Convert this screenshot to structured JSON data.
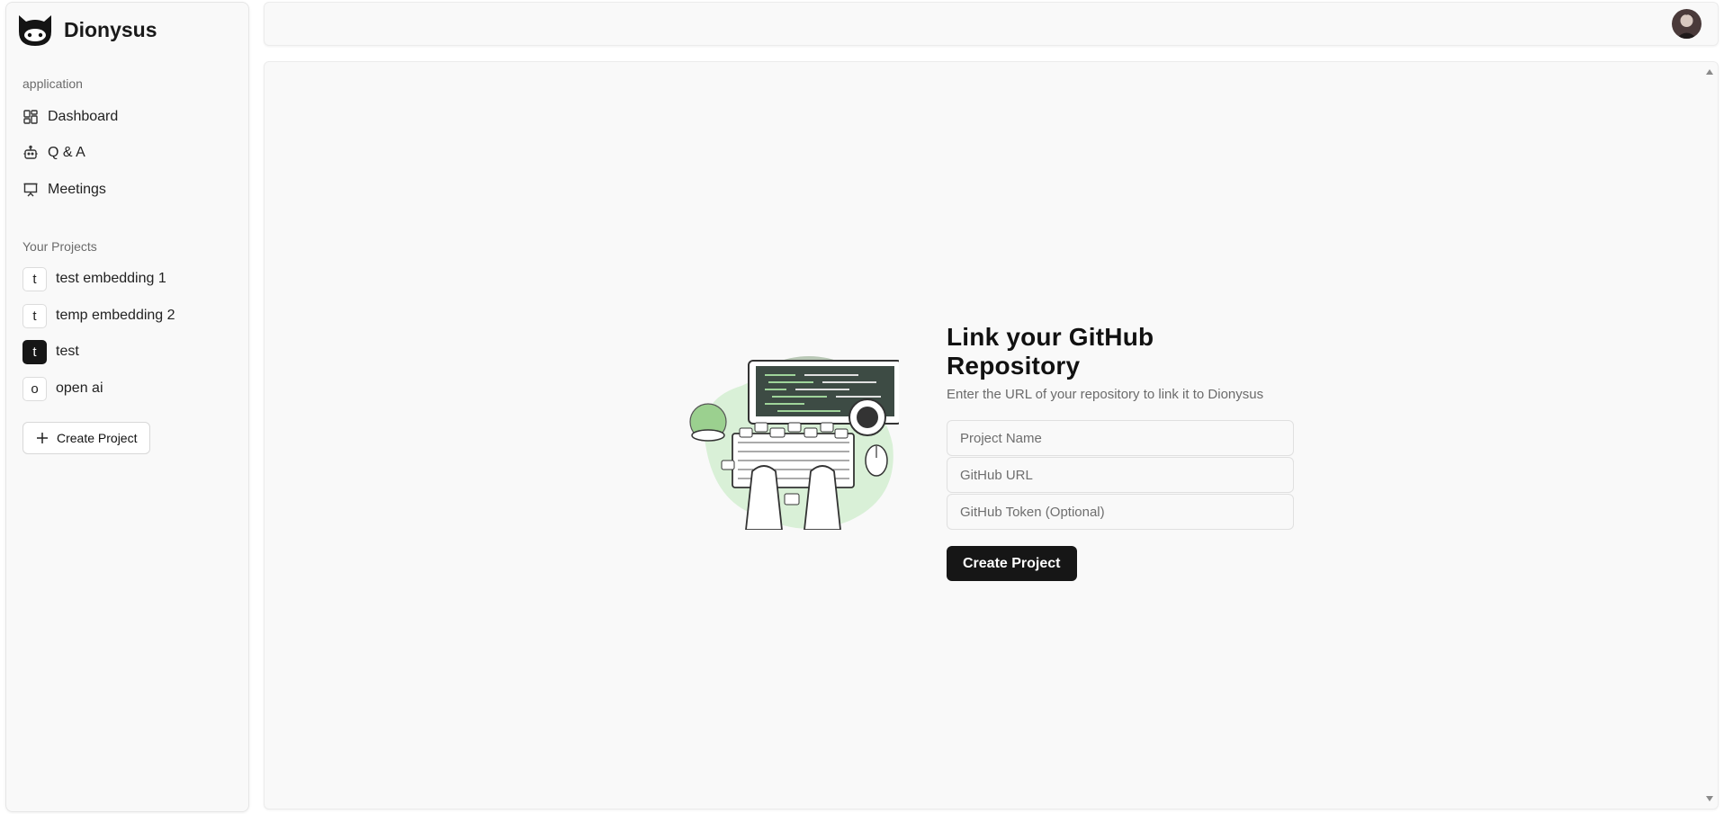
{
  "app": {
    "name": "Dionysus"
  },
  "sidebar": {
    "application_label": "application",
    "nav": [
      {
        "label": "Dashboard",
        "icon": "dashboard-icon"
      },
      {
        "label": "Q & A",
        "icon": "bot-icon"
      },
      {
        "label": "Meetings",
        "icon": "presentation-icon"
      }
    ],
    "projects_label": "Your Projects",
    "projects": [
      {
        "initial": "t",
        "label": "test embedding 1",
        "active": false
      },
      {
        "initial": "t",
        "label": "temp embedding 2",
        "active": false
      },
      {
        "initial": "t",
        "label": "test",
        "active": true
      },
      {
        "initial": "o",
        "label": "open ai",
        "active": false
      }
    ],
    "create_label": "Create Project"
  },
  "form": {
    "title": "Link your GitHub Repository",
    "subtitle": "Enter the URL of your repository to link it to Dionysus",
    "project_name_placeholder": "Project Name",
    "github_url_placeholder": "GitHub URL",
    "github_token_placeholder": "GitHub Token (Optional)",
    "submit_label": "Create Project"
  },
  "colors": {
    "primary": "#161616",
    "surface": "#f9f9f9",
    "illustration_green": "#d9f0d7"
  }
}
